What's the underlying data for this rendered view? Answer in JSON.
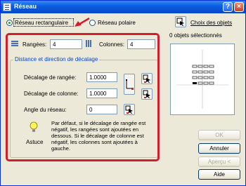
{
  "window": {
    "title": "Réseau",
    "help_button": "?",
    "close_button": "×"
  },
  "array_type": {
    "rectangular_label": "Réseau rectangulaire",
    "polar_label": "Réseau polaire",
    "selected": "rectangular"
  },
  "selection": {
    "select_objects_label": "Choix des objets",
    "count_text": "0 objets sélectionnés"
  },
  "rows": {
    "label": "Rangées:",
    "value": "4"
  },
  "columns": {
    "label": "Colonnes:",
    "value": "4"
  },
  "offset_group": {
    "title": "Distance et direction de décalage",
    "row_offset_label": "Décalage de rangée:",
    "row_offset_value": "1.0000",
    "column_offset_label": "Décalage de colonne:",
    "column_offset_value": "1.0000",
    "angle_label": "Angle du réseau:",
    "angle_value": "0"
  },
  "tip": {
    "label": "Astuce",
    "text": "Par défaut, si le décalage de rangée est négatif, les rangées sont ajoutées en dessous. Si le décalage de colonne est négatif, les colonnes sont ajoutées à gauche."
  },
  "buttons": {
    "ok": "OK",
    "cancel": "Annuler",
    "preview": "Aperçu <",
    "help": "Aide"
  },
  "colors": {
    "title_bar": "#0a5fe0",
    "annotation_red": "#d21e2a",
    "group_title": "#0046d5"
  }
}
